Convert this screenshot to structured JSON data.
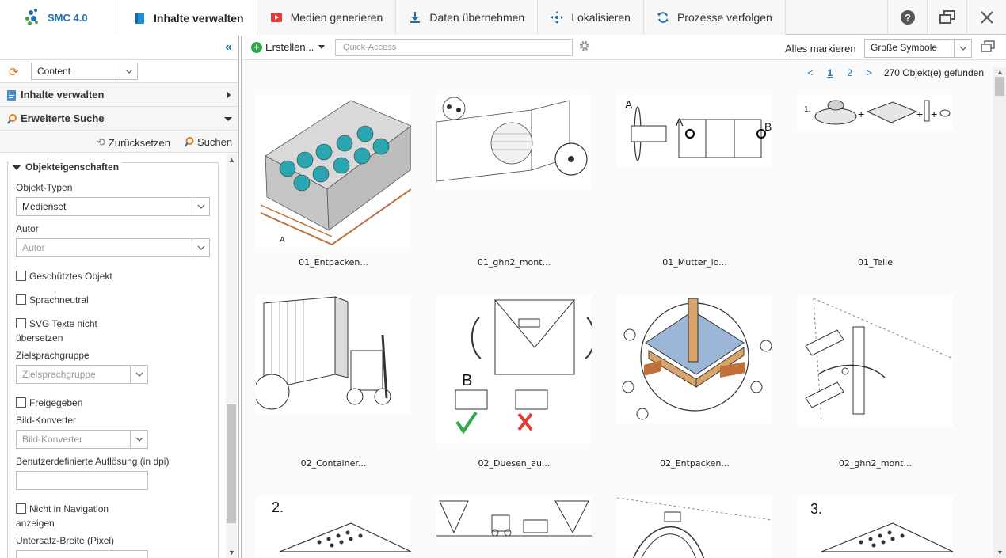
{
  "app": {
    "title": "SMC 4.0"
  },
  "nav": {
    "tabs": [
      {
        "label": "Inhalte verwalten",
        "icon": "book-icon",
        "active": true
      },
      {
        "label": "Medien generieren",
        "icon": "play-icon",
        "active": false
      },
      {
        "label": "Daten übernehmen",
        "icon": "download-icon",
        "active": false
      },
      {
        "label": "Lokalisieren",
        "icon": "crosshair-icon",
        "active": false
      },
      {
        "label": "Prozesse verfolgen",
        "icon": "refresh-icon",
        "active": false
      }
    ]
  },
  "sidebar": {
    "content_select": "Content",
    "section_manage": "Inhalte verwalten",
    "section_search": "Erweiterte Suche",
    "reset_label": "Zurücksetzen",
    "search_label": "Suchen",
    "group_title": "Objekteigenschaften",
    "object_types_label": "Objekt-Typen",
    "object_types_value": "Medienset",
    "author_label": "Autor",
    "author_placeholder": "Autor",
    "protected_label": "Geschütztes Objekt",
    "language_neutral_label": "Sprachneutral",
    "svg_label_1": "SVG Texte nicht",
    "svg_label_2": "übersetzen",
    "target_lang_label": "Zielsprachgruppe",
    "target_lang_placeholder": "Zielsprachgruppe",
    "released_label": "Freigegeben",
    "image_converter_label": "Bild-Konverter",
    "image_converter_placeholder": "Bild-Konverter",
    "resolution_label": "Benutzerdefinierte Auflösung (in dpi)",
    "not_in_nav_label_1": "Nicht in Navigation",
    "not_in_nav_label_2": "anzeigen",
    "subset_width_label": "Untersatz-Breite (Pixel)"
  },
  "toolbar": {
    "create_label": "Erstellen...",
    "quick_access_placeholder": "Quick-Access",
    "mark_all_label": "Alles markieren",
    "view_mode": "Große Symbole"
  },
  "pager": {
    "prev": "<",
    "pages": [
      "1",
      "2"
    ],
    "next": ">",
    "count": "270 Objekt(e) gefunden"
  },
  "items": [
    {
      "caption": "01_Entpacken..."
    },
    {
      "caption": "01_ghn2_mont..."
    },
    {
      "caption": "01_Mutter_lo..."
    },
    {
      "caption": "01_Teile"
    },
    {
      "caption": "02_Container..."
    },
    {
      "caption": "02_Duesen_au..."
    },
    {
      "caption": "02_Entpacken..."
    },
    {
      "caption": "02_ghn2_mont..."
    },
    {
      "caption": ""
    },
    {
      "caption": ""
    },
    {
      "caption": ""
    },
    {
      "caption": ""
    }
  ],
  "thumb_labels": {
    "t1_a": "A",
    "t3_a1": "A",
    "t3_a2": "A",
    "t3_b": "B",
    "t4_num": "1.",
    "t6_b": "B",
    "t9_num": "2.",
    "t12_num": "3."
  }
}
